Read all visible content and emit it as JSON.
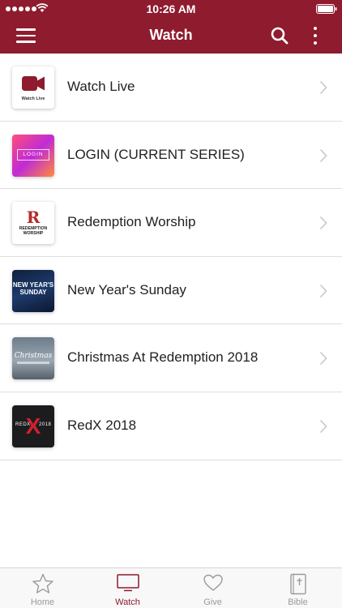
{
  "status_bar": {
    "time": "10:26 AM"
  },
  "nav": {
    "title": "Watch",
    "background_color": "#8e1b2e"
  },
  "thumbnails": {
    "watch_live_caption": "Watch Live",
    "login_text": "LOGIN",
    "worship_letter": "R",
    "worship_caption": "REDEMPTION WORSHIP",
    "new_years_caption": "NEW YEAR'S SUNDAY",
    "christmas_caption": "Christmas",
    "redx_left": "REDX",
    "redx_mark": "X",
    "redx_right": "2018"
  },
  "list": {
    "items": [
      {
        "label": "Watch Live",
        "icon": "video-camera-icon"
      },
      {
        "label": "LOGIN (CURRENT SERIES)",
        "icon": "login-series-thumbnail"
      },
      {
        "label": "Redemption Worship",
        "icon": "redemption-worship-thumbnail"
      },
      {
        "label": "New Year's Sunday",
        "icon": "new-years-sunday-thumbnail"
      },
      {
        "label": "Christmas At Redemption 2018",
        "icon": "christmas-thumbnail"
      },
      {
        "label": "RedX 2018",
        "icon": "redx-thumbnail"
      }
    ]
  },
  "tab_bar": {
    "active": "Watch",
    "tabs": [
      {
        "label": "Home",
        "icon": "star-icon"
      },
      {
        "label": "Watch",
        "icon": "tv-icon"
      },
      {
        "label": "Give",
        "icon": "heart-icon"
      },
      {
        "label": "Bible",
        "icon": "bible-icon"
      }
    ]
  }
}
